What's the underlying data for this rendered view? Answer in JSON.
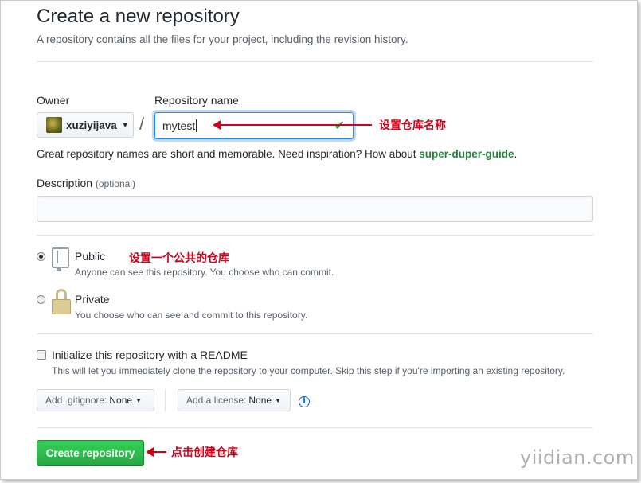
{
  "header": {
    "title": "Create a new repository",
    "subtitle": "A repository contains all the files for your project, including the revision history."
  },
  "owner": {
    "label": "Owner",
    "value": "xuziyijava"
  },
  "repo": {
    "label": "Repository name",
    "separator": "/",
    "value": "mytest",
    "hint_prefix": "Great repository names are short and memorable. Need inspiration? How about ",
    "suggestion": "super-duper-guide",
    "hint_suffix": "."
  },
  "description": {
    "label": "Description",
    "optional": "(optional)",
    "value": ""
  },
  "visibility": {
    "public": {
      "title": "Public",
      "note": "Anyone can see this repository. You choose who can commit.",
      "selected": true
    },
    "private": {
      "title": "Private",
      "note": "You choose who can see and commit to this repository.",
      "selected": false
    }
  },
  "readme": {
    "title": "Initialize this repository with a README",
    "note": "This will let you immediately clone the repository to your computer. Skip this step if you're importing an existing repository.",
    "checked": false
  },
  "gitignore": {
    "label": "Add .gitignore:",
    "value": "None"
  },
  "license": {
    "label": "Add a license:",
    "value": "None"
  },
  "create_button": "Create repository",
  "annotations": {
    "repo_name": "设置仓库名称",
    "public": "设置一个公共的仓库",
    "create": "点击创建仓库"
  },
  "watermark": "yiidian.com",
  "colors": {
    "accent": "#2188ff",
    "primary_button": "#28a745",
    "annotation": "#d0021b"
  },
  "icons": [
    "check-icon",
    "repo-book-icon",
    "lock-icon",
    "info-icon",
    "caret-down-icon"
  ]
}
